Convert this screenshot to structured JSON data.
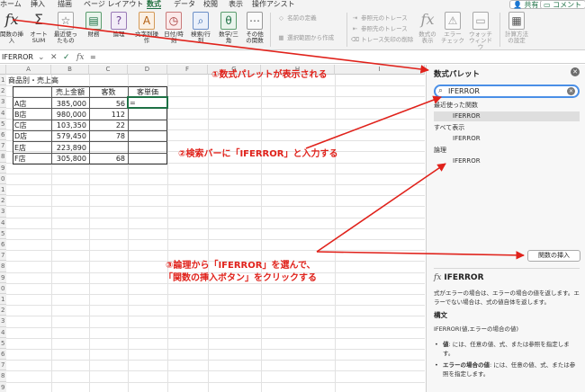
{
  "menu": {
    "tabs": [
      "ホーム",
      "挿入",
      "描画",
      "ページ レイアウト",
      "数式",
      "データ",
      "校閲",
      "表示",
      "操作アシスト"
    ],
    "active_tab": "数式",
    "share_label": "共有",
    "comment_label": "コメント"
  },
  "ribbon": {
    "insert_function": "関数の挿入",
    "autosum": "オート SUM",
    "recent": "最近使ったもの",
    "financial": "財務",
    "logical": "論理",
    "text": "文字列操作",
    "datetime": "日付/時刻",
    "lookup": "検索/行列",
    "math": "数学/三角",
    "more": "その他の関数",
    "define_name": "名前の定義",
    "create_from_selection": "選択範囲から作成",
    "trace_precedents": "参照元のトレース",
    "trace_dependents": "参照先のトレース",
    "remove_arrows": "トレース矢印の削除",
    "show_formulas": "数式の表示",
    "error_check": "エラー チェック",
    "watch_window": "ウォッチ ウィンドウ",
    "calc_options": "計算方法の設定"
  },
  "formula_bar": {
    "name_box": "IFERROR",
    "cancel_glyph": "✕",
    "enter_glyph": "✓",
    "fx_glyph": "fx",
    "content": "="
  },
  "sheet": {
    "columns": [
      "A",
      "B",
      "C",
      "D",
      "F",
      "G",
      "H",
      "I"
    ],
    "rows": [
      "1",
      "2",
      "3",
      "4",
      "5",
      "6",
      "7",
      "8",
      "9",
      "0",
      "1",
      "2",
      "3",
      "4",
      "5",
      "6",
      "7",
      "8",
      "9",
      "0",
      "1",
      "2",
      "3",
      "4",
      "5",
      "6",
      "7",
      "8",
      "9"
    ],
    "title": "商品別・売上高",
    "headers": [
      "売上金額",
      "客数",
      "客単価"
    ],
    "stores": [
      "A店",
      "B店",
      "C店",
      "D店",
      "E店",
      "F店"
    ],
    "sales": [
      "385,000",
      "980,000",
      "103,350",
      "579,450",
      "223,890",
      "305,800"
    ],
    "customers": [
      "56",
      "112",
      "22",
      "78",
      "",
      "68"
    ],
    "active_value": "="
  },
  "formula_builder": {
    "title": "数式パレット",
    "search_value": "IFERROR",
    "recent_header": "最近使った関数",
    "recent_item": "IFERROR",
    "all_header": "すべて表示",
    "all_item": "IFERROR",
    "logical_header": "論理",
    "logical_item": "IFERROR",
    "insert_button": "関数の挿入",
    "help_fx": "fx",
    "help_title": "IFERROR",
    "help_desc": "式がエラーの場合は、エラーの場合の値を返します。エラーでない場合は、式の値自体を返します。",
    "syntax_header": "構文",
    "syntax": "IFERROR(値,エラーの場合の値)",
    "arg1_name": "値",
    "arg1_desc": ": には、任意の値、式、または参照を指定します。",
    "arg2_name": "エラーの場合の値",
    "arg2_desc": ": には、任意の値、式、または参照を指定します。"
  },
  "annotations": {
    "step1": "①数式パレットが表示される",
    "step2": "②検索バーに「IFERROR」と入力する",
    "step3_line1": "③論理から「IFERROR」を選んで、",
    "step3_line2": "「関数の挿入ボタン」をクリックする",
    "color": "#e0221b"
  }
}
